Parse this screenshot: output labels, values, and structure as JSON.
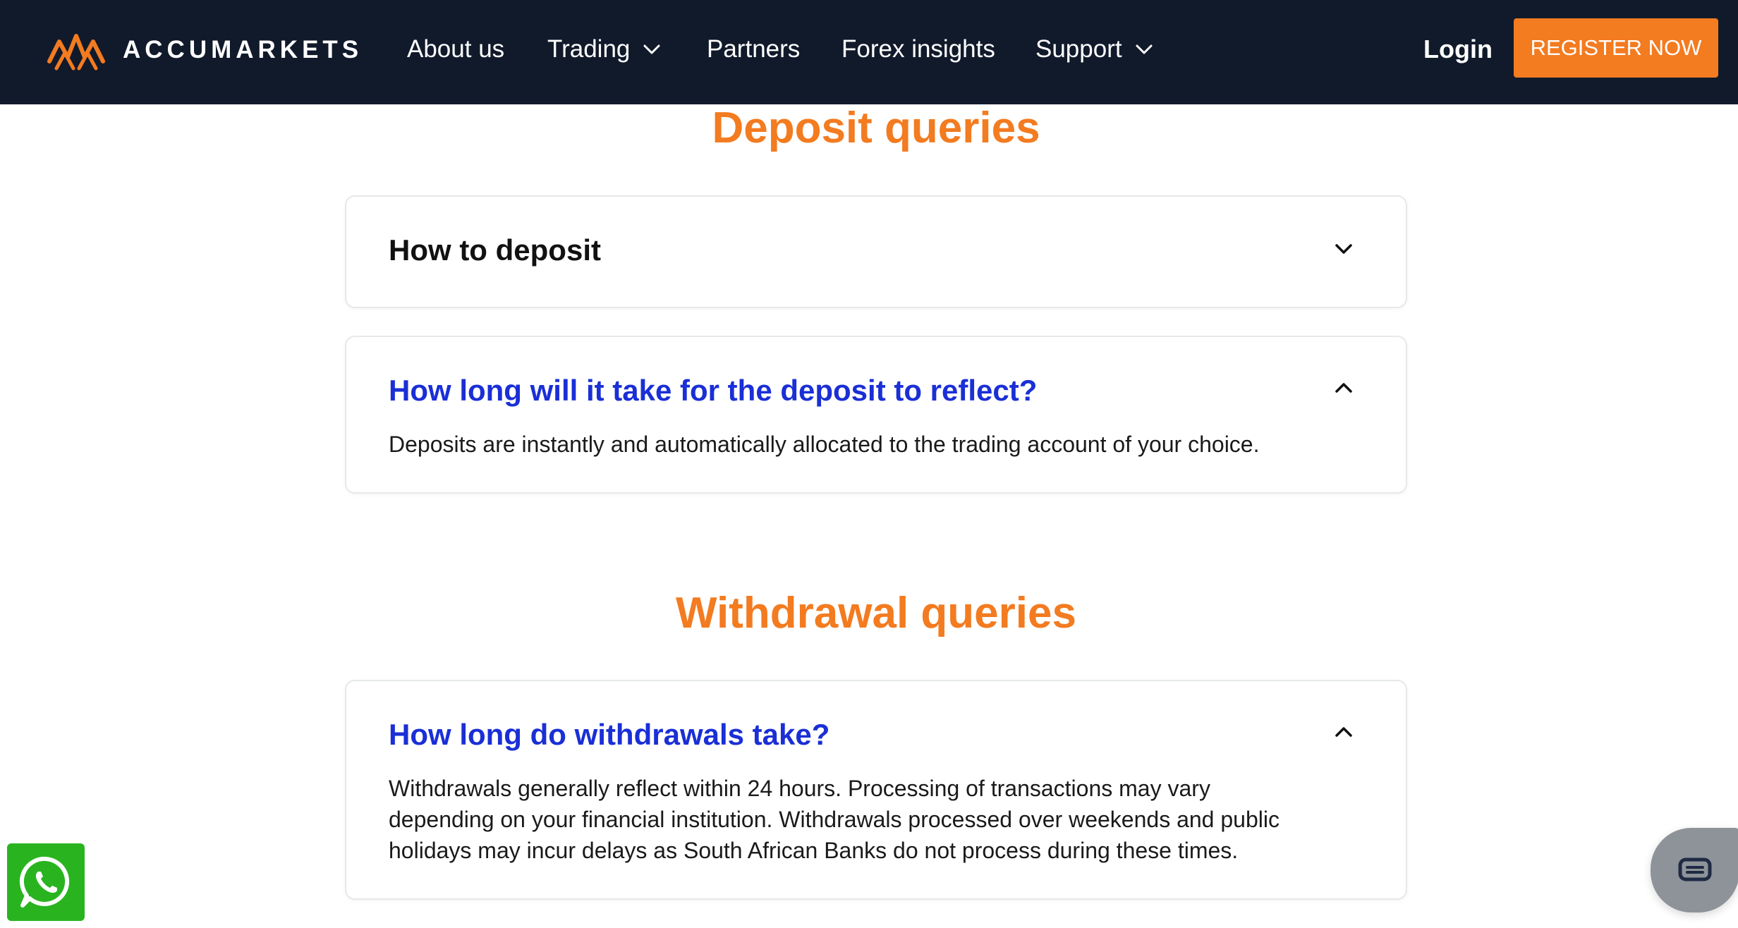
{
  "header": {
    "logo_text": "ACCUMARKETS",
    "nav": [
      {
        "label": "About us",
        "dropdown": false
      },
      {
        "label": "Trading",
        "dropdown": true
      },
      {
        "label": "Partners",
        "dropdown": false
      },
      {
        "label": "Forex insights",
        "dropdown": false
      },
      {
        "label": "Support",
        "dropdown": true
      }
    ],
    "login_label": "Login",
    "register_label": "REGISTER NOW"
  },
  "deposit": {
    "title": "Deposit queries",
    "items": [
      {
        "question": "How to deposit",
        "expanded": false
      },
      {
        "question": "How long will it take for the deposit to reflect?",
        "expanded": true,
        "answer": "Deposits are instantly and automatically allocated to the trading account of your choice."
      }
    ]
  },
  "withdrawal": {
    "title": "Withdrawal queries",
    "items": [
      {
        "question": "How long do withdrawals take?",
        "expanded": true,
        "answer": "Withdrawals generally reflect within 24 hours. Processing of transactions may vary depending on your financial institution. Withdrawals processed over weekends and public holidays may incur delays as South African Banks do not process during these times."
      }
    ]
  },
  "floating": {
    "whatsapp_icon": "whatsapp-icon",
    "chat_icon": "chat-bubble-icon"
  },
  "colors": {
    "nav_bg": "#111a2b",
    "accent": "#f37b20",
    "question_open": "#1a2fd6",
    "whatsapp": "#29b41f"
  }
}
